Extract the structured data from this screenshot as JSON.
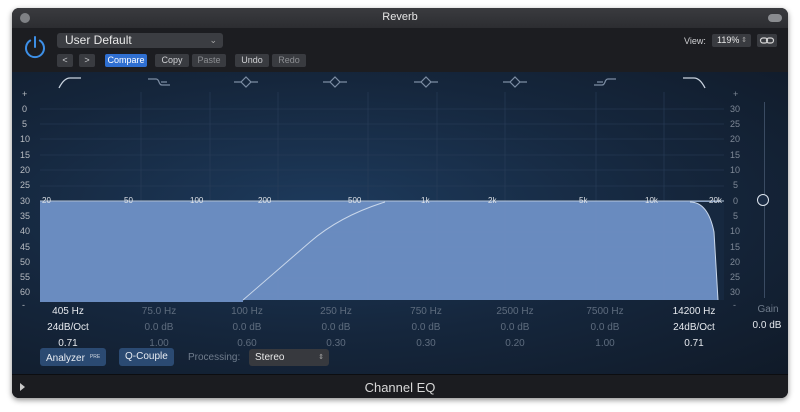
{
  "window": {
    "title": "Reverb"
  },
  "header": {
    "power_icon": "power-icon",
    "preset": "User Default",
    "nav_prev": "<",
    "nav_next": ">",
    "compare": "Compare",
    "copy": "Copy",
    "paste": "Paste",
    "undo": "Undo",
    "redo": "Redo",
    "view_label": "View:",
    "view_value": "119%",
    "link_icon": "link-icon"
  },
  "band_icons": [
    "low-cut-icon",
    "low-shelf-icon",
    "bell-icon",
    "bell-icon",
    "bell-icon",
    "bell-icon",
    "high-shelf-icon",
    "high-cut-icon"
  ],
  "db_scale": [
    "+",
    "0",
    "5",
    "10",
    "15",
    "20",
    "25",
    "30",
    "35",
    "40",
    "45",
    "50",
    "55",
    "60",
    "-"
  ],
  "gain_scale": [
    "+",
    "30",
    "25",
    "20",
    "15",
    "10",
    "5",
    "0",
    "5",
    "10",
    "15",
    "20",
    "25",
    "30",
    "-"
  ],
  "freq_labels": [
    "20",
    "50",
    "100",
    "200",
    "500",
    "1k",
    "2k",
    "5k",
    "10k",
    "20k"
  ],
  "bands": [
    {
      "freq": "405 Hz",
      "slope": "24dB/Oct",
      "q": "0.71",
      "active": true
    },
    {
      "freq": "75.0 Hz",
      "slope": "0.0 dB",
      "q": "1.00",
      "active": false
    },
    {
      "freq": "100 Hz",
      "slope": "0.0 dB",
      "q": "0.60",
      "active": false
    },
    {
      "freq": "250 Hz",
      "slope": "0.0 dB",
      "q": "0.30",
      "active": false
    },
    {
      "freq": "750 Hz",
      "slope": "0.0 dB",
      "q": "0.30",
      "active": false
    },
    {
      "freq": "2500 Hz",
      "slope": "0.0 dB",
      "q": "0.20",
      "active": false
    },
    {
      "freq": "7500 Hz",
      "slope": "0.0 dB",
      "q": "1.00",
      "active": false
    },
    {
      "freq": "14200 Hz",
      "slope": "24dB/Oct",
      "q": "0.71",
      "active": true
    }
  ],
  "gain": {
    "label": "Gain",
    "value": "0.0 dB"
  },
  "bottom": {
    "analyzer": "Analyzer",
    "analyzer_badge": "PRE",
    "q_couple": "Q-Couple",
    "processing_label": "Processing:",
    "processing_value": "Stereo"
  },
  "footer": {
    "plugin_name": "Channel EQ"
  },
  "colors": {
    "accent": "#2f6fd1",
    "curve_fill": "#6a8cc0",
    "background": "#15263c"
  }
}
